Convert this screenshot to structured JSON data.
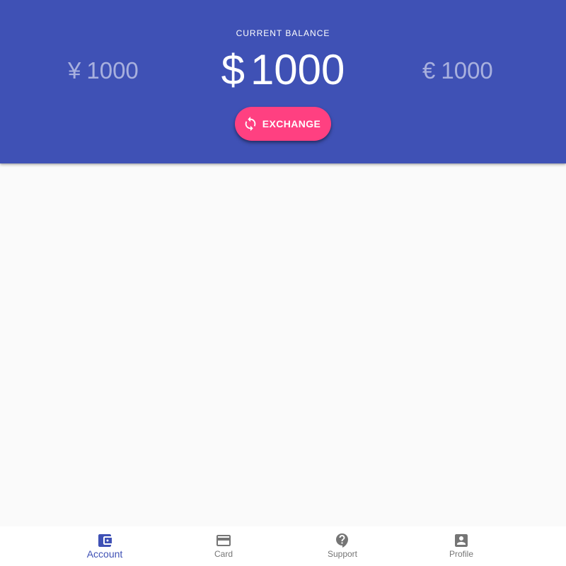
{
  "header": {
    "balance_label": "CURRENT BALANCE",
    "balances": {
      "left": {
        "symbol": "¥",
        "amount": "1000"
      },
      "main": {
        "symbol": "$",
        "amount": "1000"
      },
      "right": {
        "symbol": "€",
        "amount": "1000"
      }
    },
    "exchange_button": {
      "label": "EXCHANGE",
      "icon": "sync-icon"
    }
  },
  "bottom_nav": {
    "items": [
      {
        "label": "Account",
        "icon": "wallet-icon",
        "active": true
      },
      {
        "label": "Card",
        "icon": "credit-card-icon",
        "active": false
      },
      {
        "label": "Support",
        "icon": "help-icon",
        "active": false
      },
      {
        "label": "Profile",
        "icon": "account-box-icon",
        "active": false
      }
    ]
  },
  "colors": {
    "primary": "#3f51b5",
    "accent": "#ff4081",
    "background": "#fafafa",
    "inactive_nav": "#757575"
  }
}
